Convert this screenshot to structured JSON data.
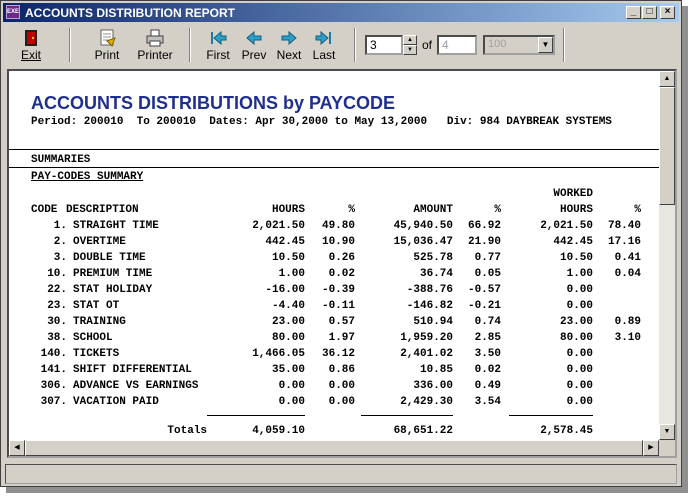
{
  "window": {
    "title": "ACCOUNTS DISTRIBUTION REPORT",
    "icon_label": "EXE"
  },
  "toolbar": {
    "exit": "Exit",
    "print": "Print",
    "printer": "Printer",
    "first": "First",
    "prev": "Prev",
    "next": "Next",
    "last": "Last",
    "page_value": "3",
    "of_label": "of",
    "total_pages": "4",
    "zoom": "100"
  },
  "report": {
    "title": "ACCOUNTS DISTRIBUTIONS by PAYCODE",
    "period_line": "Period: 200010  To 200010  Dates: Apr 30,2000 to May 13,2000   Div: 984 DAYBREAK SYSTEMS",
    "summaries": "SUMMARIES",
    "pay_codes_summary": "PAY-CODES SUMMARY",
    "headers": {
      "worked": "WORKED",
      "code": "CODE",
      "description": "DESCRIPTION",
      "hours": "HOURS",
      "pct1": "%",
      "amount": "AMOUNT",
      "pct2": "%",
      "worked_hours": "HOURS",
      "pct3": "%"
    },
    "rows": [
      {
        "code": "1.",
        "desc": "STRAIGHT TIME",
        "hours": "2,021.50",
        "hpct": "49.80",
        "amount": "45,940.50",
        "apct": "66.92",
        "whours": "2,021.50",
        "wpct": "78.40"
      },
      {
        "code": "2.",
        "desc": "OVERTIME",
        "hours": "442.45",
        "hpct": "10.90",
        "amount": "15,036.47",
        "apct": "21.90",
        "whours": "442.45",
        "wpct": "17.16"
      },
      {
        "code": "3.",
        "desc": "DOUBLE TIME",
        "hours": "10.50",
        "hpct": "0.26",
        "amount": "525.78",
        "apct": "0.77",
        "whours": "10.50",
        "wpct": "0.41"
      },
      {
        "code": "10.",
        "desc": "PREMIUM TIME",
        "hours": "1.00",
        "hpct": "0.02",
        "amount": "36.74",
        "apct": "0.05",
        "whours": "1.00",
        "wpct": "0.04"
      },
      {
        "code": "22.",
        "desc": "STAT HOLIDAY",
        "hours": "-16.00",
        "hpct": "-0.39",
        "amount": "-388.76",
        "apct": "-0.57",
        "whours": "0.00",
        "wpct": ""
      },
      {
        "code": "23.",
        "desc": "STAT OT",
        "hours": "-4.40",
        "hpct": "-0.11",
        "amount": "-146.82",
        "apct": "-0.21",
        "whours": "0.00",
        "wpct": ""
      },
      {
        "code": "30.",
        "desc": "TRAINING",
        "hours": "23.00",
        "hpct": "0.57",
        "amount": "510.94",
        "apct": "0.74",
        "whours": "23.00",
        "wpct": "0.89"
      },
      {
        "code": "38.",
        "desc": "SCHOOL",
        "hours": "80.00",
        "hpct": "1.97",
        "amount": "1,959.20",
        "apct": "2.85",
        "whours": "80.00",
        "wpct": "3.10"
      },
      {
        "code": "140.",
        "desc": "TICKETS",
        "hours": "1,466.05",
        "hpct": "36.12",
        "amount": "2,401.02",
        "apct": "3.50",
        "whours": "0.00",
        "wpct": ""
      },
      {
        "code": "141.",
        "desc": "SHIFT DIFFERENTIAL",
        "hours": "35.00",
        "hpct": "0.86",
        "amount": "10.85",
        "apct": "0.02",
        "whours": "0.00",
        "wpct": ""
      },
      {
        "code": "306.",
        "desc": "ADVANCE VS EARNINGS",
        "hours": "0.00",
        "hpct": "0.00",
        "amount": "336.00",
        "apct": "0.49",
        "whours": "0.00",
        "wpct": ""
      },
      {
        "code": "307.",
        "desc": "VACATION PAID",
        "hours": "0.00",
        "hpct": "0.00",
        "amount": "2,429.30",
        "apct": "3.54",
        "whours": "0.00",
        "wpct": ""
      }
    ],
    "totals": {
      "label": "Totals",
      "hours": "4,059.10",
      "amount": "68,651.22",
      "whours": "2,578.45"
    }
  }
}
